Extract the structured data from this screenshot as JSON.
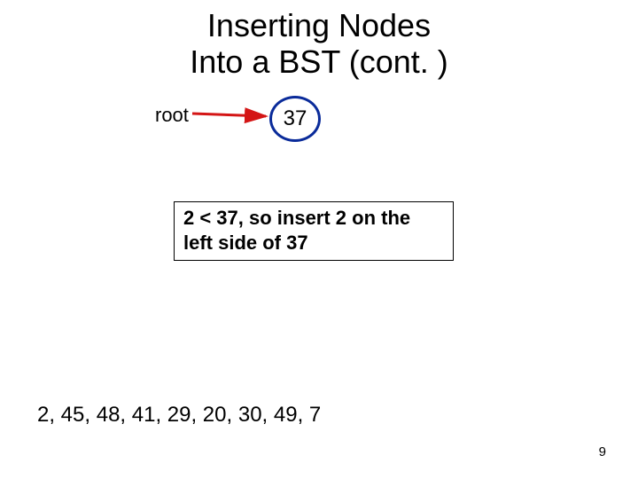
{
  "title": {
    "line1": "Inserting Nodes",
    "line2": "Into a BST (cont. )"
  },
  "tree": {
    "rootLabel": "root",
    "rootValue": "37"
  },
  "explanation": "2 < 37, so insert 2 on the left side of 37",
  "sequence": "2, 45, 48, 41, 29, 20, 30, 49, 7",
  "pageNumber": "9",
  "colors": {
    "nodeBorder": "#0a2b9a",
    "arrow": "#d41515"
  }
}
